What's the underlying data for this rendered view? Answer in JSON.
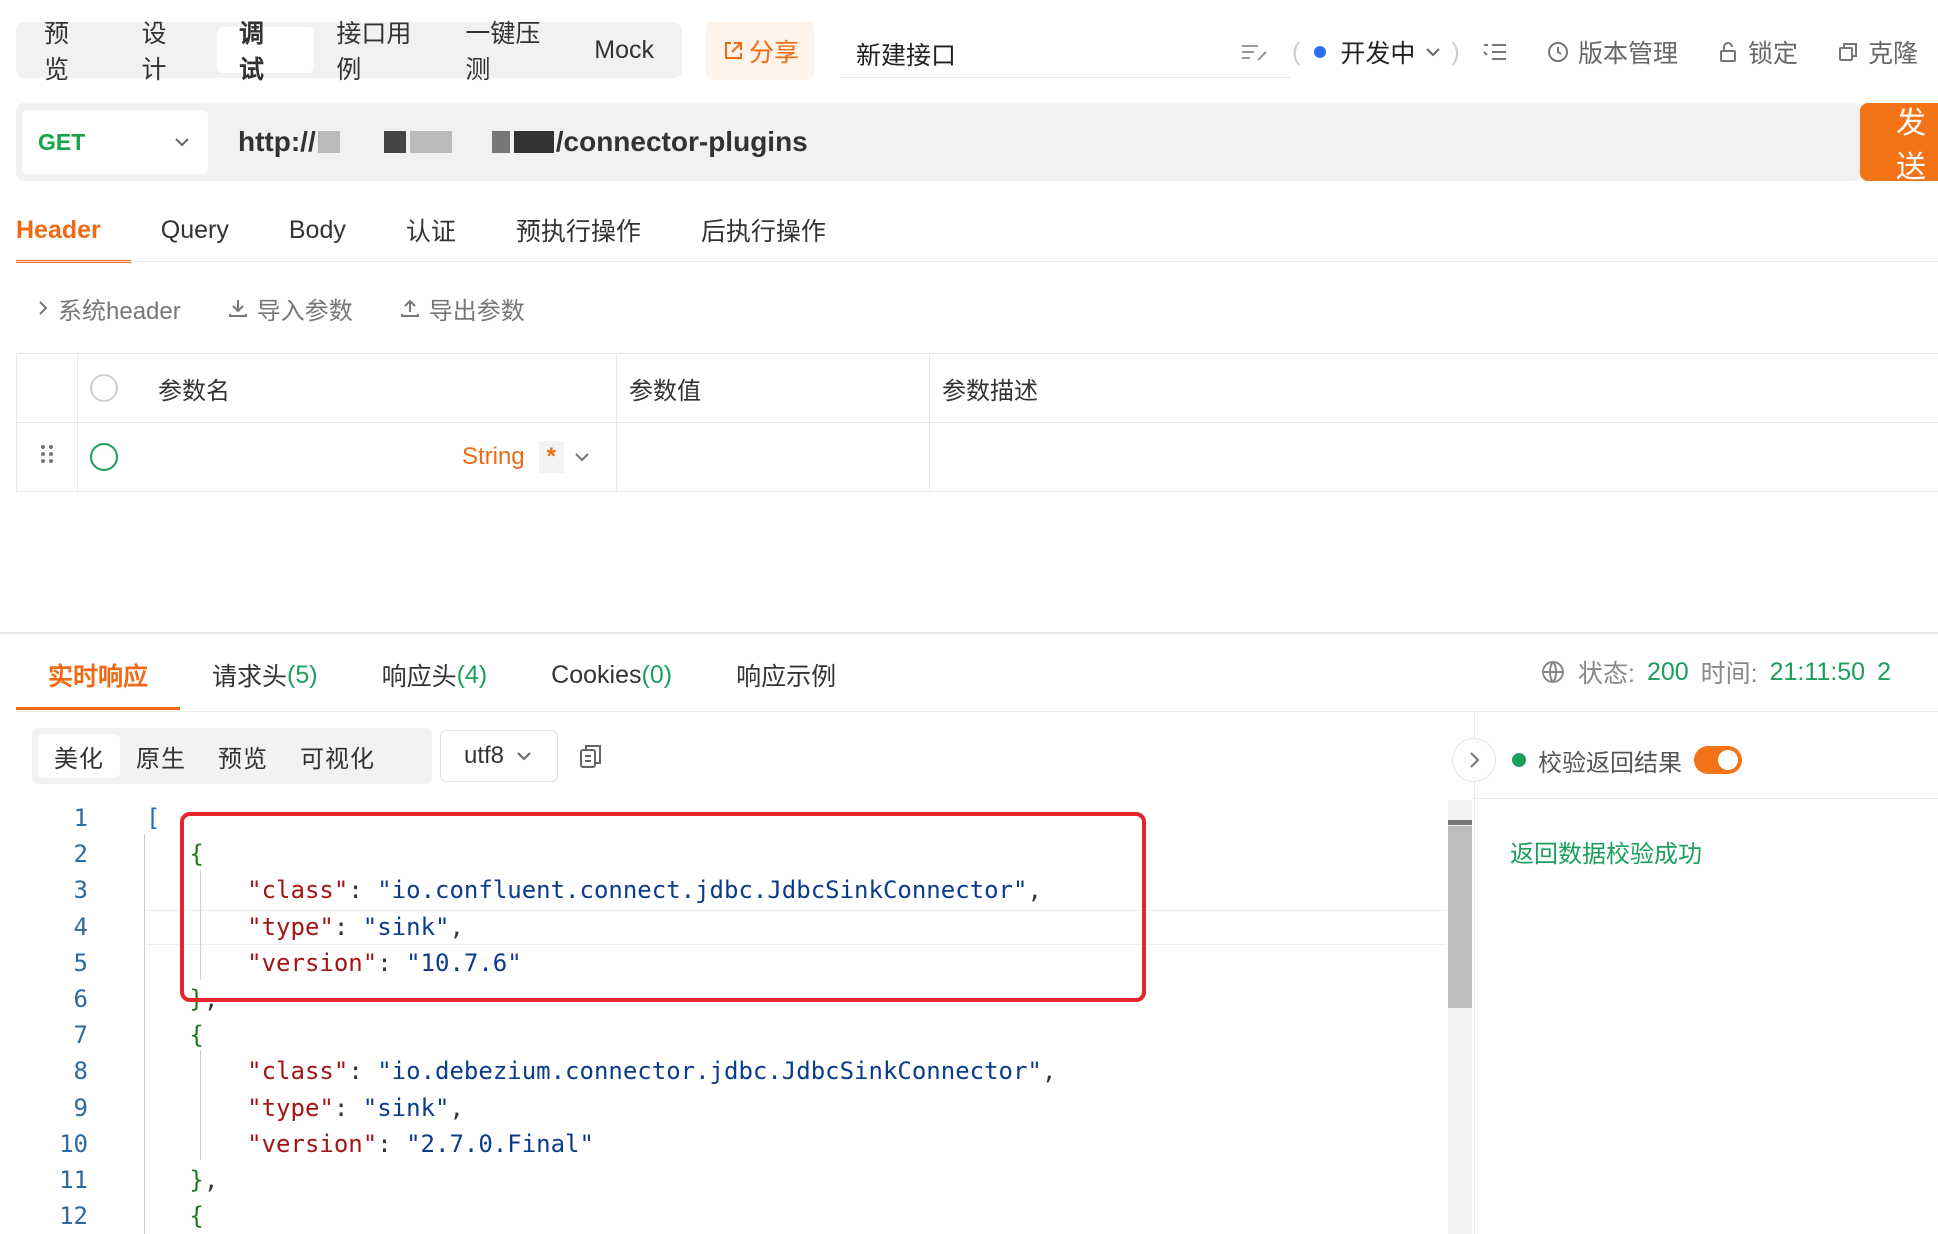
{
  "top_tabs": [
    "预 览",
    "设 计",
    "调 试",
    "接口用例",
    "一键压测",
    "Mock"
  ],
  "share_label": "分享",
  "api_name": "新建接口",
  "status_select": "开发中",
  "toolbar": {
    "version": "版本管理",
    "lock": "锁定",
    "clone": "克隆"
  },
  "request": {
    "method": "GET",
    "url_prefix": "http://",
    "url_suffix": "/connector-plugins",
    "send_label": "发 送"
  },
  "param_tabs": [
    "Header",
    "Query",
    "Body",
    "认证",
    "预执行操作",
    "后执行操作"
  ],
  "header_tools": {
    "system_header": "系统header",
    "import": "导入参数",
    "export": "导出参数"
  },
  "param_table": {
    "columns": [
      "参数名",
      "参数值",
      "参数描述"
    ],
    "row": {
      "type": "String",
      "required_mark": "*"
    }
  },
  "response_tabs": [
    {
      "label": "实时响应",
      "count": ""
    },
    {
      "label": "请求头",
      "count": "(5)"
    },
    {
      "label": "响应头",
      "count": "(4)"
    },
    {
      "label": "Cookies",
      "count": "(0)"
    },
    {
      "label": "响应示例",
      "count": ""
    }
  ],
  "response_status": {
    "status_label": "状态:",
    "status_value": "200",
    "time_label": "时间:",
    "time_value": "21:11:50",
    "extra": "2"
  },
  "format_tabs": [
    "美化",
    "原生",
    "预览",
    "可视化"
  ],
  "encoding": "utf8",
  "verify": {
    "label": "校验返回结果",
    "result": "返回数据校验成功"
  },
  "code_lines": [
    {
      "n": "1",
      "indent": 0,
      "parts": [
        [
          "b",
          "["
        ]
      ]
    },
    {
      "n": "2",
      "indent": 1,
      "parts": [
        [
          "p",
          "{"
        ]
      ]
    },
    {
      "n": "3",
      "indent": 2,
      "parts": [
        [
          "k",
          "\"class\""
        ],
        [
          "x",
          ": "
        ],
        [
          "s",
          "\"io.confluent.connect.jdbc.JdbcSinkConnector\""
        ],
        [
          "x",
          ","
        ]
      ]
    },
    {
      "n": "4",
      "indent": 2,
      "parts": [
        [
          "k",
          "\"type\""
        ],
        [
          "x",
          ": "
        ],
        [
          "s",
          "\"sink\""
        ],
        [
          "x",
          ","
        ]
      ]
    },
    {
      "n": "5",
      "indent": 2,
      "parts": [
        [
          "k",
          "\"version\""
        ],
        [
          "x",
          ": "
        ],
        [
          "s",
          "\"10.7.6\""
        ]
      ]
    },
    {
      "n": "6",
      "indent": 1,
      "parts": [
        [
          "p",
          "}"
        ],
        [
          "x",
          ","
        ]
      ]
    },
    {
      "n": "7",
      "indent": 1,
      "parts": [
        [
          "p",
          "{"
        ]
      ]
    },
    {
      "n": "8",
      "indent": 2,
      "parts": [
        [
          "k",
          "\"class\""
        ],
        [
          "x",
          ": "
        ],
        [
          "s",
          "\"io.debezium.connector.jdbc.JdbcSinkConnector\""
        ],
        [
          "x",
          ","
        ]
      ]
    },
    {
      "n": "9",
      "indent": 2,
      "parts": [
        [
          "k",
          "\"type\""
        ],
        [
          "x",
          ": "
        ],
        [
          "s",
          "\"sink\""
        ],
        [
          "x",
          ","
        ]
      ]
    },
    {
      "n": "10",
      "indent": 2,
      "parts": [
        [
          "k",
          "\"version\""
        ],
        [
          "x",
          ": "
        ],
        [
          "s",
          "\"2.7.0.Final\""
        ]
      ]
    },
    {
      "n": "11",
      "indent": 1,
      "parts": [
        [
          "p",
          "}"
        ],
        [
          "x",
          ","
        ]
      ]
    },
    {
      "n": "12",
      "indent": 1,
      "parts": [
        [
          "p",
          "{"
        ]
      ]
    }
  ],
  "colors": {
    "accent": "#f57317",
    "success": "#1aa05a",
    "highlight_box": "#e5252b"
  }
}
